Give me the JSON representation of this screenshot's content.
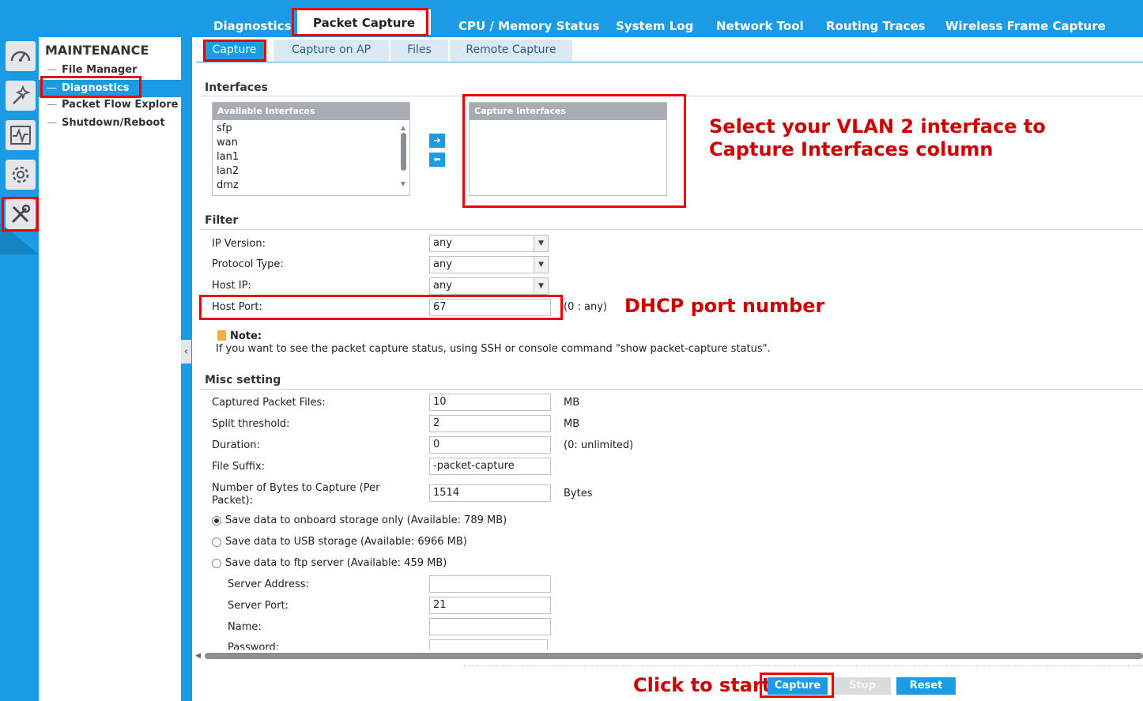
{
  "top_tabs": [
    "Diagnostics",
    "Packet Capture",
    "CPU / Memory Status",
    "System Log",
    "Network Tool",
    "Routing Traces",
    "Wireless Frame Capture"
  ],
  "menu": {
    "title": "MAINTENANCE",
    "items": [
      "File Manager",
      "Diagnostics",
      "Packet Flow Explore",
      "Shutdown/Reboot"
    ]
  },
  "sub_tabs": [
    "Capture",
    "Capture on AP",
    "Files",
    "Remote Capture"
  ],
  "interfaces": {
    "section": "Interfaces",
    "available_header": "Available Interfaces",
    "available": [
      "sfp",
      "wan",
      "lan1",
      "lan2",
      "dmz"
    ],
    "capture_header": "Capture Interfaces",
    "move_right": "➔",
    "move_left": "⬅"
  },
  "filter": {
    "section": "Filter",
    "ip_version_label": "IP Version:",
    "ip_version": "any",
    "protocol_label": "Protocol Type:",
    "protocol": "any",
    "host_ip_label": "Host IP:",
    "host_ip": "any",
    "host_port_label": "Host Port:",
    "host_port": "67",
    "host_port_hint": "(0 : any)",
    "note_title": "Note:",
    "note_text": "If you want to see the packet capture status, using SSH or console command \"show packet-capture status\"."
  },
  "misc": {
    "section": "Misc setting",
    "files_label": "Captured Packet Files:",
    "files": "10",
    "files_unit": "MB",
    "split_label": "Split threshold:",
    "split": "2",
    "split_unit": "MB",
    "duration_label": "Duration:",
    "duration": "0",
    "duration_unit": "(0: unlimited)",
    "suffix_label": "File Suffix:",
    "suffix": "-packet-capture",
    "bytes_label_1": "Number of Bytes to Capture (Per",
    "bytes_label_2": "Packet):",
    "bytes": "1514",
    "bytes_unit": "Bytes",
    "radio_onboard": "Save data to onboard storage only (Available: 789 MB)",
    "radio_usb": "Save data to USB storage (Available: 6966 MB)",
    "radio_ftp": "Save data to ftp server (Available: 459 MB)",
    "server_address_label": "Server Address:",
    "server_address": "",
    "server_port_label": "Server Port:",
    "server_port": "21",
    "name_label": "Name:",
    "name": "",
    "password_label": "Password:"
  },
  "buttons": {
    "capture": "Capture",
    "stop": "Stop",
    "reset": "Reset"
  },
  "annotations": {
    "interface_1": "Select your VLAN 2 interface to",
    "interface_2": "Capture Interfaces column",
    "port": "DHCP port number",
    "start": "Click to start"
  },
  "colors": {
    "accent": "#1a9be3",
    "annotation": "#cc0000"
  }
}
